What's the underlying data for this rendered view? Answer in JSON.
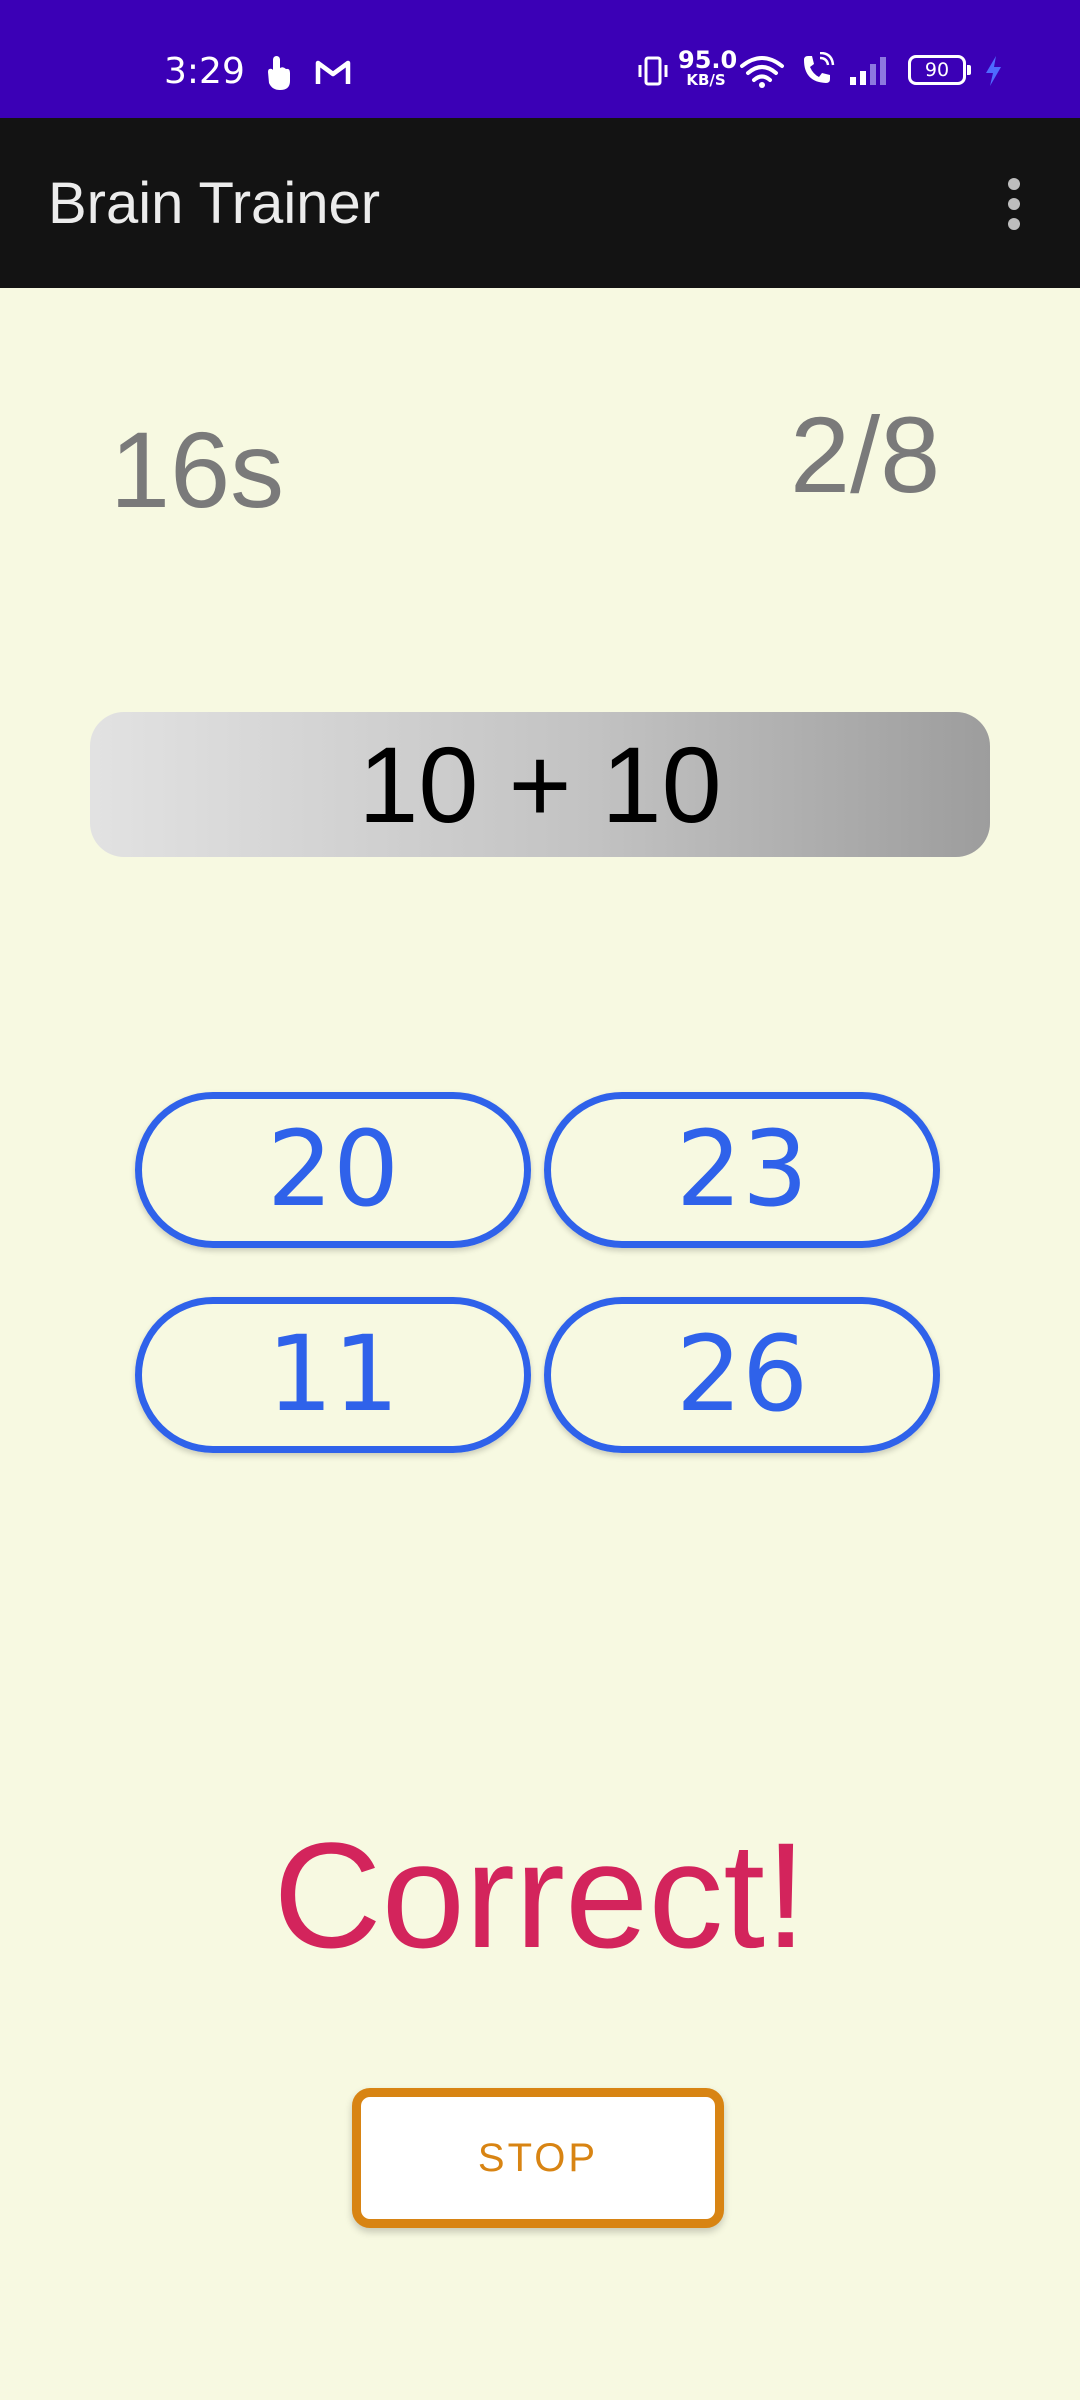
{
  "status_bar": {
    "time": "3:29",
    "net_speed_value": "95.0",
    "net_speed_unit": "KB/S",
    "battery_level": "90",
    "icons": [
      "touch-icon",
      "gmail-icon",
      "vibrate-icon",
      "wifi-icon",
      "wifi-call-icon",
      "signal-icon",
      "battery-icon",
      "charging-icon"
    ]
  },
  "app_bar": {
    "title": "Brain Trainer",
    "menu_icon": "more-vert-icon"
  },
  "game": {
    "timer": "16s",
    "score": "2/8",
    "question": "10 + 10",
    "answers": [
      "20",
      "23",
      "11",
      "26"
    ],
    "result": "Correct!",
    "stop_label": "STOP"
  },
  "colors": {
    "status_bar": "#3b00b6",
    "app_bar": "#131313",
    "background": "#f7f9e1",
    "answer_accent": "#2f62ea",
    "result_text": "#d3245c",
    "stop_accent": "#d88413",
    "muted_text": "#7a7a7a"
  }
}
